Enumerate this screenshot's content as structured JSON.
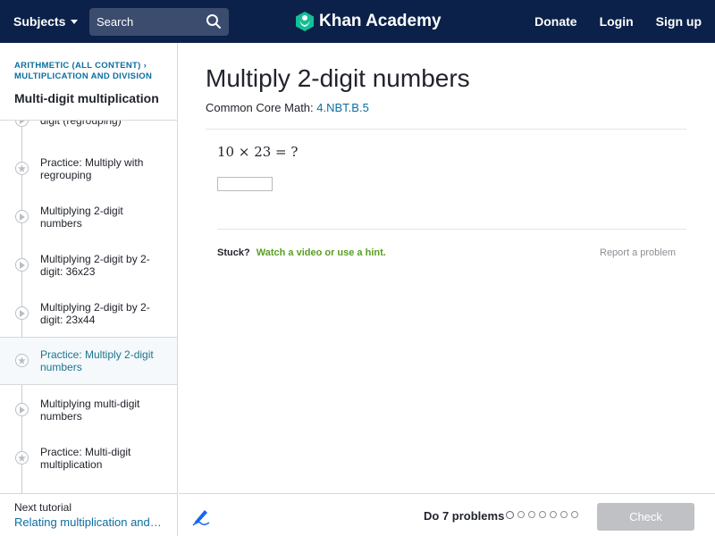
{
  "header": {
    "subjects_label": "Subjects",
    "search_placeholder": "Search",
    "brand": "Khan Academy",
    "nav": {
      "donate": "Donate",
      "login": "Login",
      "signup": "Sign up"
    }
  },
  "sidebar": {
    "breadcrumbs": [
      "ARITHMETIC (ALL CONTENT)",
      "MULTIPLICATION AND DIVISION"
    ],
    "tutorial_title": "Multi-digit multiplication",
    "items": [
      {
        "label": "digit (regrouping)",
        "type": "video"
      },
      {
        "label": "Practice: Multiply with regrouping",
        "type": "practice"
      },
      {
        "label": "Multiplying 2-digit numbers",
        "type": "video"
      },
      {
        "label": "Multiplying 2-digit by 2-digit: 36x23",
        "type": "video"
      },
      {
        "label": "Multiplying 2-digit by 2-digit: 23x44",
        "type": "video"
      },
      {
        "label": "Practice: Multiply 2-digit numbers",
        "type": "practice",
        "active": true
      },
      {
        "label": "Multiplying multi-digit numbers",
        "type": "video"
      },
      {
        "label": "Practice: Multi-digit multiplication",
        "type": "practice"
      }
    ],
    "next": {
      "label": "Next tutorial",
      "link": "Relating multiplication and…"
    }
  },
  "main": {
    "title": "Multiply 2-digit numbers",
    "standard_prefix": "Common Core Math:",
    "standard_code": "4.NBT.B.5",
    "question": "10 × 23 = ?",
    "answer_value": "",
    "stuck": "Stuck?",
    "hint": "Watch a video or use a hint.",
    "report": "Report a problem"
  },
  "footer": {
    "do_problems": "Do 7 problems",
    "problem_count": 7,
    "check_label": "Check"
  },
  "colors": {
    "header_bg": "#0b2149",
    "link_blue": "#0b6ea0",
    "active_teal": "#1c758a",
    "hint_green": "#5a9e23",
    "disabled_button": "#bfc1c4"
  }
}
